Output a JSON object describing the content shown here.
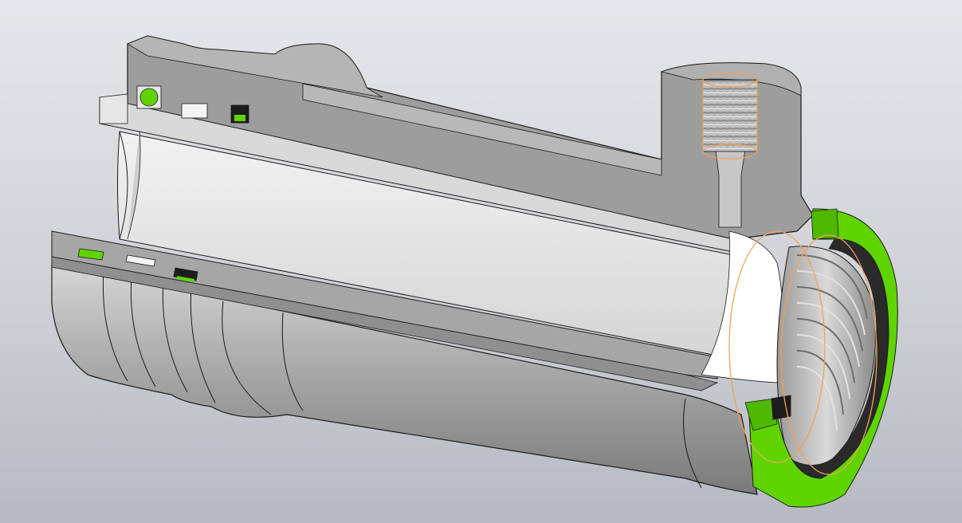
{
  "viewport": {
    "background_top": "#e6e7ea",
    "background_bottom": "#b6b9c2"
  },
  "model": {
    "view": "isometric-section-cut",
    "colors": {
      "section_face": "#9d9d9d",
      "body_light": "#c9c9c9",
      "body_mid": "#a8a8a8",
      "body_dark": "#7e7e7e",
      "bore": "#e3e3e3",
      "seal_green": "#5fd400",
      "seal_black": "#1c1c1c",
      "highlight_orange": "#f0a25a",
      "edge": "#1a1a1a"
    },
    "features": [
      "outer-housing",
      "inner-sleeve",
      "radial-port",
      "threaded-port",
      "threaded-end",
      "o-ring-green",
      "o-ring-black",
      "retaining-washer",
      "flange-collar"
    ]
  }
}
